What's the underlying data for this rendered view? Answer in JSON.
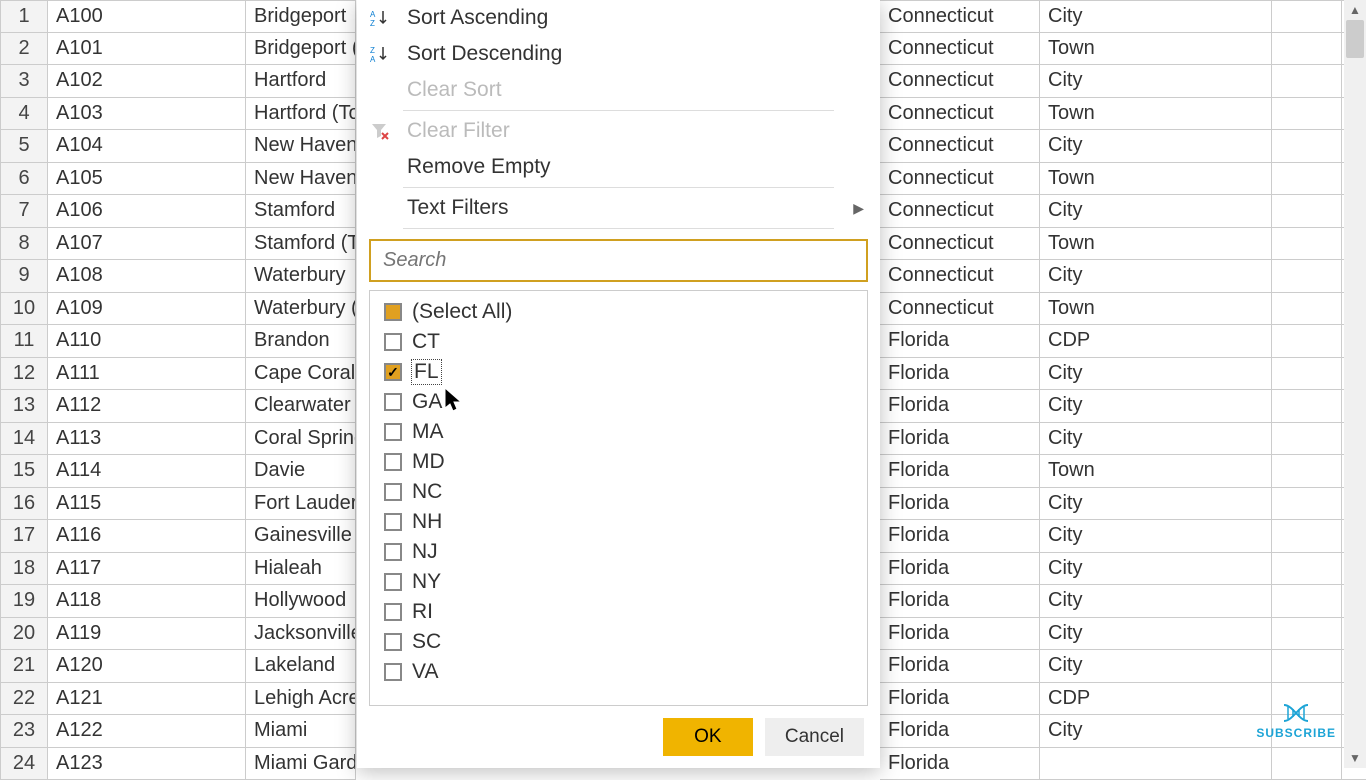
{
  "grid": {
    "rows": [
      {
        "n": "1",
        "id": "A100",
        "city": "Bridgeport",
        "state": "Connecticut",
        "type": "City"
      },
      {
        "n": "2",
        "id": "A101",
        "city": "Bridgeport (To",
        "state": "Connecticut",
        "type": "Town"
      },
      {
        "n": "3",
        "id": "A102",
        "city": "Hartford",
        "state": "Connecticut",
        "type": "City"
      },
      {
        "n": "4",
        "id": "A103",
        "city": "Hartford (Tow",
        "state": "Connecticut",
        "type": "Town"
      },
      {
        "n": "5",
        "id": "A104",
        "city": "New Haven",
        "state": "Connecticut",
        "type": "City"
      },
      {
        "n": "6",
        "id": "A105",
        "city": "New Haven (T",
        "state": "Connecticut",
        "type": "Town"
      },
      {
        "n": "7",
        "id": "A106",
        "city": "Stamford",
        "state": "Connecticut",
        "type": "City"
      },
      {
        "n": "8",
        "id": "A107",
        "city": "Stamford (Tow",
        "state": "Connecticut",
        "type": "Town"
      },
      {
        "n": "9",
        "id": "A108",
        "city": "Waterbury",
        "state": "Connecticut",
        "type": "City"
      },
      {
        "n": "10",
        "id": "A109",
        "city": "Waterbury (To",
        "state": "Connecticut",
        "type": "Town"
      },
      {
        "n": "11",
        "id": "A110",
        "city": "Brandon",
        "state": "Florida",
        "type": "CDP"
      },
      {
        "n": "12",
        "id": "A111",
        "city": "Cape Coral",
        "state": "Florida",
        "type": "City"
      },
      {
        "n": "13",
        "id": "A112",
        "city": "Clearwater",
        "state": "Florida",
        "type": "City"
      },
      {
        "n": "14",
        "id": "A113",
        "city": "Coral Springs",
        "state": "Florida",
        "type": "City"
      },
      {
        "n": "15",
        "id": "A114",
        "city": "Davie",
        "state": "Florida",
        "type": "Town"
      },
      {
        "n": "16",
        "id": "A115",
        "city": "Fort Lauderda",
        "state": "Florida",
        "type": "City"
      },
      {
        "n": "17",
        "id": "A116",
        "city": "Gainesville",
        "state": "Florida",
        "type": "City"
      },
      {
        "n": "18",
        "id": "A117",
        "city": "Hialeah",
        "state": "Florida",
        "type": "City"
      },
      {
        "n": "19",
        "id": "A118",
        "city": "Hollywood",
        "state": "Florida",
        "type": "City"
      },
      {
        "n": "20",
        "id": "A119",
        "city": "Jacksonville",
        "state": "Florida",
        "type": "City"
      },
      {
        "n": "21",
        "id": "A120",
        "city": "Lakeland",
        "state": "Florida",
        "type": "City"
      },
      {
        "n": "22",
        "id": "A121",
        "city": "Lehigh Acres",
        "state": "Florida",
        "type": "CDP"
      },
      {
        "n": "23",
        "id": "A122",
        "city": "Miami",
        "state": "Florida",
        "type": "City"
      },
      {
        "n": "24",
        "id": "A123",
        "city": "Miami Garden",
        "state": "Florida",
        "type": ""
      }
    ]
  },
  "menu": {
    "sort_asc": "Sort Ascending",
    "sort_desc": "Sort Descending",
    "clear_sort": "Clear Sort",
    "clear_filter": "Clear Filter",
    "remove_empty": "Remove Empty",
    "text_filters": "Text Filters",
    "search_placeholder": "Search",
    "select_all": "(Select All)",
    "options": [
      {
        "label": "CT",
        "checked": false
      },
      {
        "label": "FL",
        "checked": true,
        "focus": true
      },
      {
        "label": "GA",
        "checked": false,
        "cursor_over": true
      },
      {
        "label": "MA",
        "checked": false
      },
      {
        "label": "MD",
        "checked": false
      },
      {
        "label": "NC",
        "checked": false
      },
      {
        "label": "NH",
        "checked": false
      },
      {
        "label": "NJ",
        "checked": false
      },
      {
        "label": "NY",
        "checked": false
      },
      {
        "label": "RI",
        "checked": false
      },
      {
        "label": "SC",
        "checked": false
      },
      {
        "label": "VA",
        "checked": false
      }
    ],
    "ok": "OK",
    "cancel": "Cancel"
  },
  "badge": {
    "label": "SUBSCRIBE"
  }
}
